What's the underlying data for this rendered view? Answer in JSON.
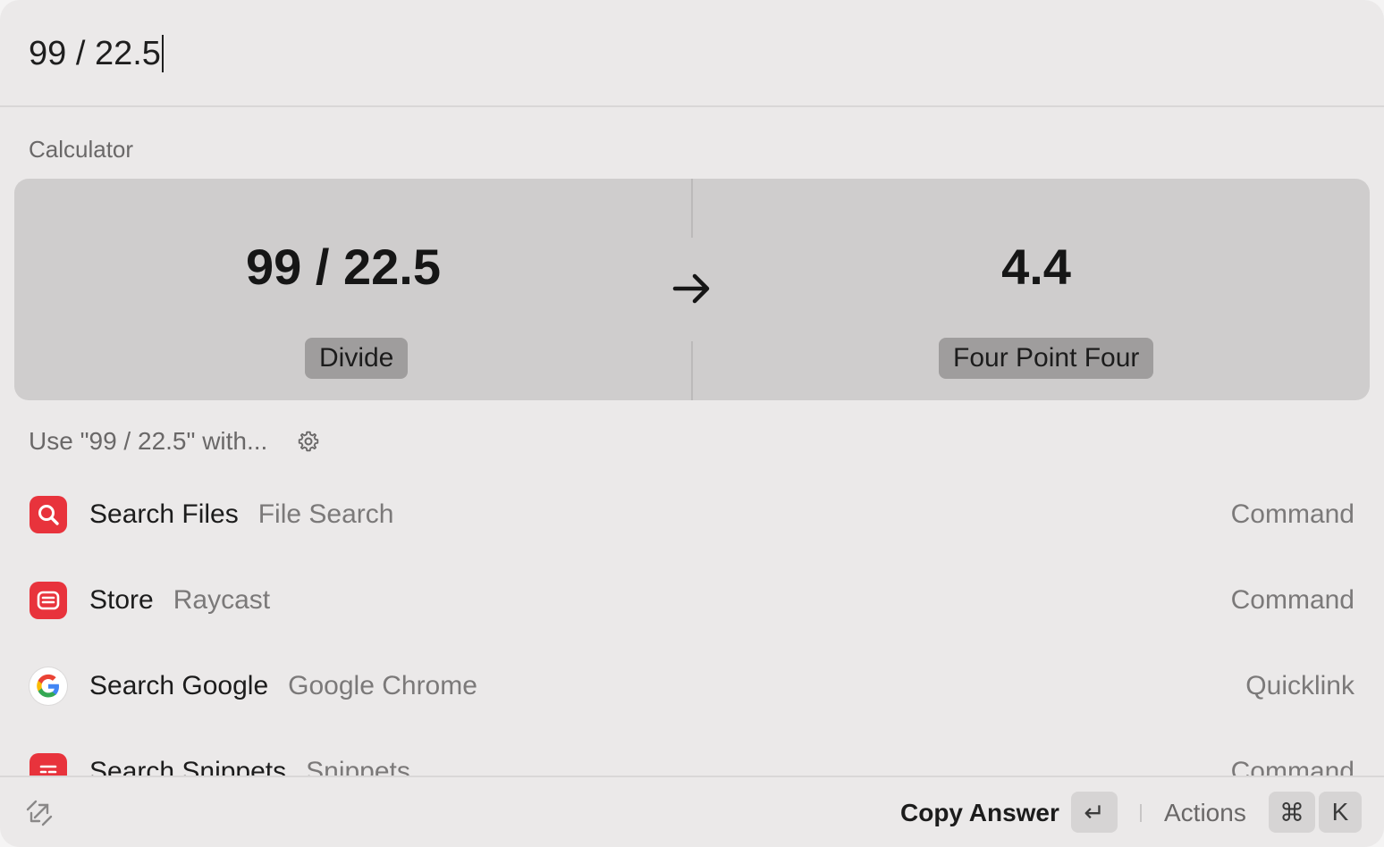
{
  "search": {
    "query": "99 / 22.5"
  },
  "calculator": {
    "section_label": "Calculator",
    "expression": "99 / 22.5",
    "operation": "Divide",
    "result": "4.4",
    "result_words": "Four Point Four"
  },
  "use_with": {
    "label": "Use \"99 / 22.5\" with..."
  },
  "results": [
    {
      "title": "Search Files",
      "subtitle": "File Search",
      "kind": "Command",
      "icon": "magnifier-icon",
      "color": "#e8333c"
    },
    {
      "title": "Store",
      "subtitle": "Raycast",
      "kind": "Command",
      "icon": "store-icon",
      "color": "#e8333c"
    },
    {
      "title": "Search Google",
      "subtitle": "Google Chrome",
      "kind": "Quicklink",
      "icon": "google-icon",
      "color": "#ffffff"
    },
    {
      "title": "Search Snippets",
      "subtitle": "Snippets",
      "kind": "Command",
      "icon": "snippets-icon",
      "color": "#e8333c"
    }
  ],
  "footer": {
    "primary_action": "Copy Answer",
    "enter_key": "↵",
    "actions_label": "Actions",
    "cmd_key": "⌘",
    "k_key": "K"
  }
}
